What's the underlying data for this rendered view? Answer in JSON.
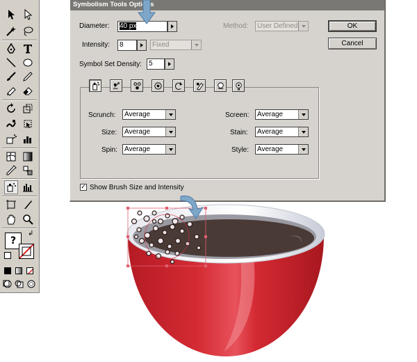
{
  "dialog": {
    "title": "Symbolism Tools Options",
    "diameter_label": "Diameter:",
    "diameter_value": "40 px",
    "method_label": "Method:",
    "method_value": "User Defined",
    "intensity_label": "Intensity:",
    "intensity_value": "8",
    "intensity_mode": "Fixed",
    "density_label": "Symbol Set Density:",
    "density_value": "5",
    "ok_label": "OK",
    "cancel_label": "Cancel",
    "symbol_tools": [
      "symbol-sprayer-icon",
      "symbol-shifter-icon",
      "symbol-scruncher-icon",
      "symbol-sizer-icon",
      "symbol-spinner-icon",
      "symbol-stainer-icon",
      "symbol-screener-icon",
      "symbol-styler-icon"
    ],
    "left_options": [
      {
        "label": "Scrunch:",
        "value": "Average"
      },
      {
        "label": "Size:",
        "value": "Average"
      },
      {
        "label": "Spin:",
        "value": "Average"
      }
    ],
    "right_options": [
      {
        "label": "Screen:",
        "value": "Average"
      },
      {
        "label": "Stain:",
        "value": "Average"
      },
      {
        "label": "Style:",
        "value": "Average"
      }
    ],
    "show_brush_label": "Show Brush Size and Intensity",
    "show_brush_checked": true
  },
  "colors": {
    "cup_red": "#d42a33",
    "coffee": "#4a3a36",
    "dialog_bg": "#d6d3ce",
    "arrow_blue": "#7ea6c8"
  }
}
